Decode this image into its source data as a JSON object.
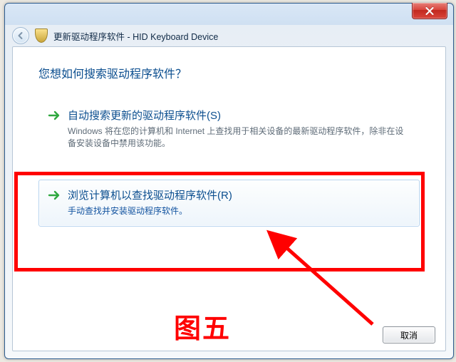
{
  "window": {
    "title": "更新驱动程序软件 - HID Keyboard Device"
  },
  "heading": "您想如何搜索驱动程序软件？",
  "options": [
    {
      "title": "自动搜索更新的驱动程序软件(S)",
      "desc": "Windows 将在您的计算机和 Internet 上查找用于相关设备的最新驱动程序软件，除非在设备安装设备中禁用该功能。"
    },
    {
      "title": "浏览计算机以查找驱动程序软件(R)",
      "desc": "手动查找并安装驱动程序软件。"
    }
  ],
  "buttons": {
    "cancel": "取消"
  },
  "annotation": {
    "caption": "图五"
  }
}
